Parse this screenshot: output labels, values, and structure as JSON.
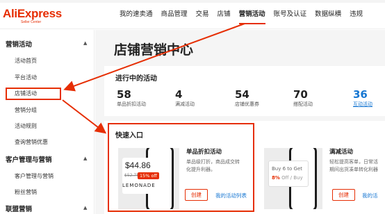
{
  "header": {
    "logo": "AliExpress",
    "logo_sub": "Seller Center",
    "nav": [
      "我的速卖通",
      "商品管理",
      "交易",
      "店铺",
      "营销活动",
      "账号及认证",
      "数据纵横",
      "违规"
    ]
  },
  "sidebar": {
    "groups": [
      {
        "label": "营销活动",
        "items": [
          "活动首页",
          "平台活动",
          "店铺活动",
          "营销分组",
          "活动规则",
          "查询营销优惠"
        ]
      },
      {
        "label": "客户管理与营销",
        "items": [
          "客户管理与营销",
          "粉丝营销"
        ]
      },
      {
        "label": "联盟营销",
        "items": []
      }
    ],
    "active_item": "店铺活动"
  },
  "main": {
    "title": "店铺营销中心",
    "ongoing": {
      "title": "进行中的活动",
      "stats": [
        {
          "value": "58",
          "label": "单品折扣活动"
        },
        {
          "value": "4",
          "label": "满减活动"
        },
        {
          "value": "54",
          "label": "店铺优惠券"
        },
        {
          "value": "70",
          "label": "搭配活动"
        },
        {
          "value": "36",
          "label": "互动活动"
        }
      ]
    },
    "quick": {
      "title": "快速入口",
      "promos": [
        {
          "title": "单品折扣活动",
          "desc1": "单品级打折，商品成交转",
          "desc2": "化提升利器。",
          "create": "创建",
          "list": "我的活动列表",
          "thumb_price": "$44.86",
          "thumb_old": "$52.78",
          "thumb_badge": "15% off",
          "thumb_word": "LEMONADE"
        },
        {
          "title": "满减活动",
          "desc1": "轻松提高客单，日常活",
          "desc2": "期间出货凑单转化利器",
          "create": "创建",
          "list": "我的活",
          "thumb_line1": "Buy 6 to Get",
          "thumb_pct": "8%",
          "thumb_line2": " Off / Buy"
        }
      ]
    }
  },
  "colors": {
    "accent": "#e62e04",
    "link": "#1777d2",
    "bg": "#f5f5f5"
  }
}
